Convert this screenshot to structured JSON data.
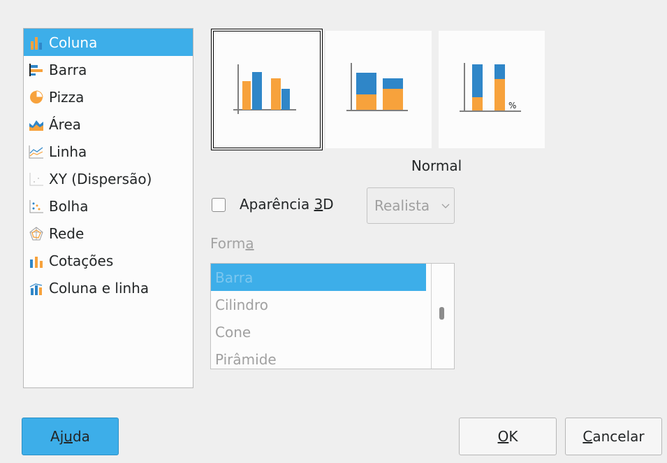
{
  "chart_types": [
    {
      "label": "Coluna",
      "icon": "column-chart-icon",
      "selected": true
    },
    {
      "label": "Barra",
      "icon": "bar-chart-icon",
      "selected": false
    },
    {
      "label": "Pizza",
      "icon": "pie-chart-icon",
      "selected": false
    },
    {
      "label": "Área",
      "icon": "area-chart-icon",
      "selected": false
    },
    {
      "label": "Linha",
      "icon": "line-chart-icon",
      "selected": false
    },
    {
      "label": "XY (Dispersão)",
      "icon": "scatter-chart-icon",
      "selected": false
    },
    {
      "label": "Bolha",
      "icon": "bubble-chart-icon",
      "selected": false
    },
    {
      "label": "Rede",
      "icon": "net-chart-icon",
      "selected": false
    },
    {
      "label": "Cotações",
      "icon": "stock-chart-icon",
      "selected": false
    },
    {
      "label": "Coluna e linha",
      "icon": "column-line-chart-icon",
      "selected": false
    }
  ],
  "variants": {
    "selected": "normal",
    "caption": "Normal",
    "percent_mark": "%"
  },
  "appearance_3d": {
    "label_pre": "Aparência ",
    "label_accel": "3",
    "label_post": "D",
    "checked": false,
    "select_value": "Realista"
  },
  "forma": {
    "label_pre": "Form",
    "label_accel": "a",
    "items": [
      {
        "label": "Barra",
        "selected": true
      },
      {
        "label": "Cilindro",
        "selected": false
      },
      {
        "label": "Cone",
        "selected": false
      },
      {
        "label": "Pirâmide",
        "selected": false
      }
    ]
  },
  "buttons": {
    "help_pre": "Aj",
    "help_accel": "u",
    "help_post": "da",
    "ok_accel": "O",
    "ok_post": "K",
    "cancel_accel": "C",
    "cancel_post": "ancelar"
  },
  "colors": {
    "accent": "#3daee9",
    "chart_orange": "#f7a23c",
    "chart_blue": "#2f86c8"
  }
}
